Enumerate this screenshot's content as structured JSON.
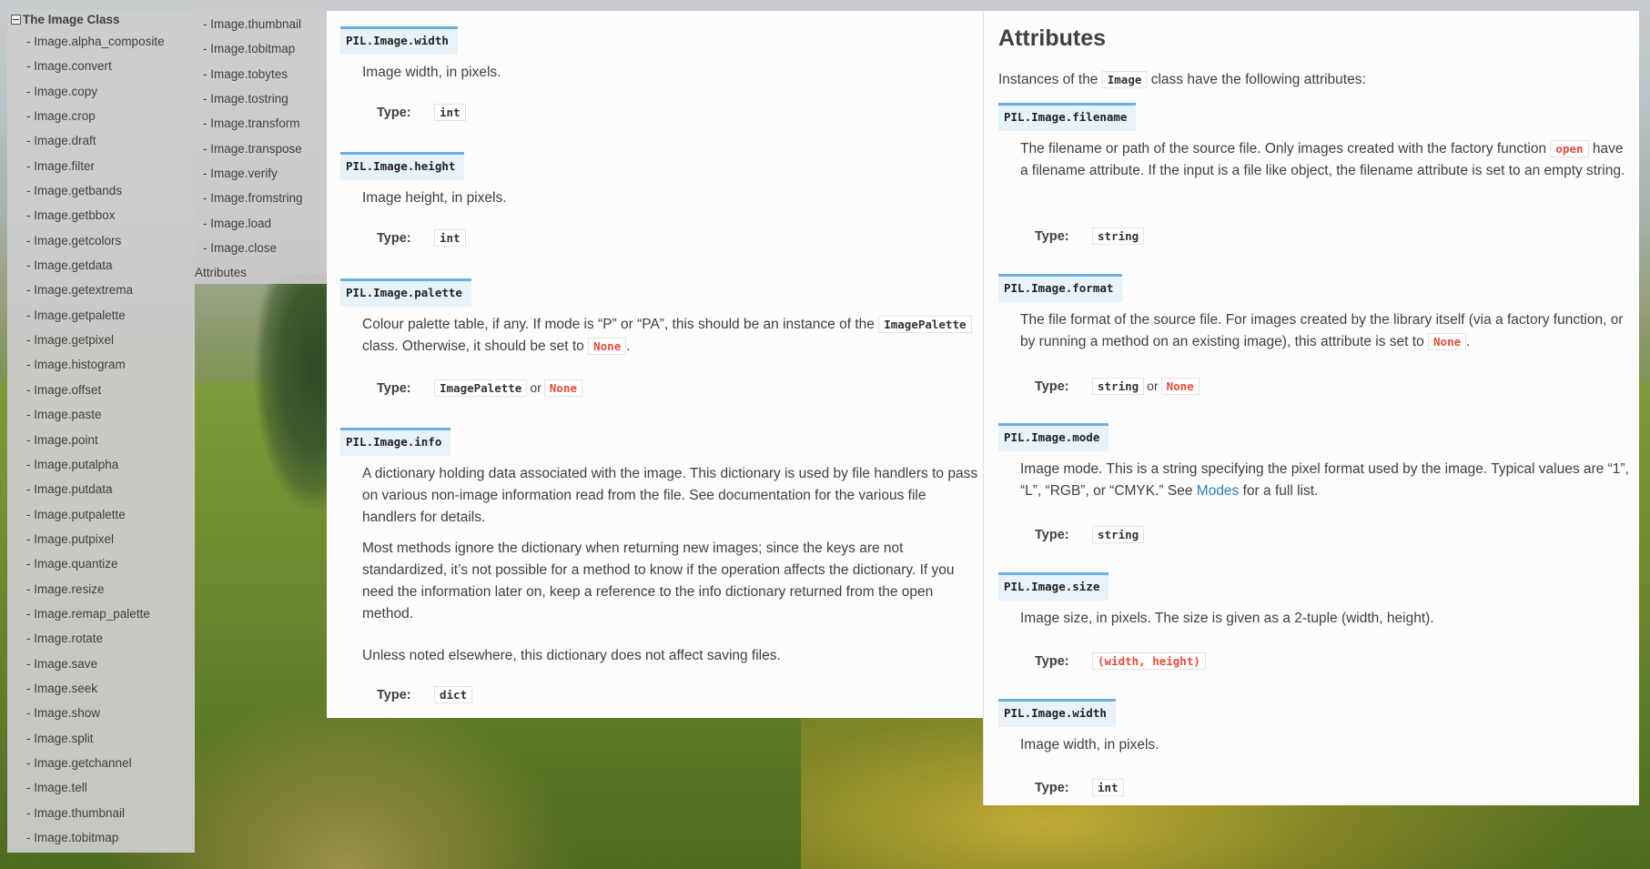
{
  "sidebar": {
    "title": "The Image Class",
    "items": [
      "- Image.alpha_composite",
      "- Image.convert",
      "- Image.copy",
      "- Image.crop",
      "- Image.draft",
      "- Image.filter",
      "- Image.getbands",
      "- Image.getbbox",
      "- Image.getcolors",
      "- Image.getdata",
      "- Image.getextrema",
      "- Image.getpalette",
      "- Image.getpixel",
      "- Image.histogram",
      "- Image.offset",
      "- Image.paste",
      "- Image.point",
      "- Image.putalpha",
      "- Image.putdata",
      "- Image.putpalette",
      "- Image.putpixel",
      "- Image.quantize",
      "- Image.resize",
      "- Image.remap_palette",
      "- Image.rotate",
      "- Image.save",
      "- Image.seek",
      "- Image.show",
      "- Image.split",
      "- Image.getchannel",
      "- Image.tell",
      "- Image.thumbnail",
      "- Image.tobitmap"
    ]
  },
  "sidebar2": {
    "items": [
      "- Image.thumbnail",
      "- Image.tobitmap",
      "- Image.tobytes",
      "- Image.tostring",
      "- Image.transform",
      "- Image.transpose",
      "- Image.verify",
      "- Image.fromstring",
      "- Image.load",
      "- Image.close"
    ],
    "attributes_link": "Attributes"
  },
  "left_panel": {
    "width": {
      "sig": "PIL.Image.width",
      "desc": "Image width, in pixels.",
      "type_label": "Type:",
      "type": "int"
    },
    "height": {
      "sig": "PIL.Image.height",
      "desc": "Image height, in pixels.",
      "type_label": "Type:",
      "type": "int"
    },
    "palette": {
      "sig": "PIL.Image.palette",
      "desc_1": "Colour palette table, if any. If mode is “P” or “PA”, this should be an instance of the",
      "desc_code_1": "ImagePalette",
      "desc_2": "class. Otherwise, it should be set to",
      "desc_code_2": "None",
      "desc_end": ".",
      "type_label": "Type:",
      "type_a": "ImagePalette",
      "or": "or",
      "type_b": "None"
    },
    "info": {
      "sig": "PIL.Image.info",
      "p1": "A dictionary holding data associated with the image. This dictionary is used by file handlers to pass on various non-image information read from the file. See documentation for the various file handlers for details.",
      "p2": "Most methods ignore the dictionary when returning new images; since the keys are not standardized, it’s not possible for a method to know if the operation affects the dictionary. If you need the information later on, keep a reference to the info dictionary returned from the open method.",
      "p3": "Unless noted elsewhere, this dictionary does not affect saving files.",
      "type_label": "Type:",
      "type": "dict"
    }
  },
  "right_panel": {
    "heading": "Attributes",
    "intro_1": "Instances of the",
    "intro_code": "Image",
    "intro_2": "class have the following attributes:",
    "filename": {
      "sig": "PIL.Image.filename",
      "desc_1": "The filename or path of the source file. Only images created with the factory function",
      "desc_code": "open",
      "desc_2": "have a filename attribute. If the input is a file like object, the filename attribute is set to an empty string.",
      "type_label": "Type:",
      "type": "string"
    },
    "format": {
      "sig": "PIL.Image.format",
      "desc_1": "The file format of the source file. For images created by the library itself (via a factory function, or by running a method on an existing image), this attribute is set to",
      "desc_code": "None",
      "desc_end": ".",
      "type_label": "Type:",
      "type_a": "string",
      "or": "or",
      "type_b": "None"
    },
    "mode": {
      "sig": "PIL.Image.mode",
      "desc_1": "Image mode. This is a string specifying the pixel format used by the image. Typical values are “1”, “L”, “RGB”, or “CMYK.” See",
      "desc_link": "Modes",
      "desc_2": "for a full list.",
      "type_label": "Type:",
      "type": "string"
    },
    "size": {
      "sig": "PIL.Image.size",
      "desc": "Image size, in pixels. The size is given as a 2-tuple (width, height).",
      "type_label": "Type:",
      "type": "(width, height)"
    },
    "width": {
      "sig": "PIL.Image.width",
      "desc": "Image width, in pixels.",
      "type_label": "Type:",
      "type": "int"
    }
  },
  "colors": {
    "link": "#2980b9",
    "literal_red": "#e74c3c",
    "sig_bg": "#e7f2fa",
    "sig_border": "#6ab0de"
  }
}
